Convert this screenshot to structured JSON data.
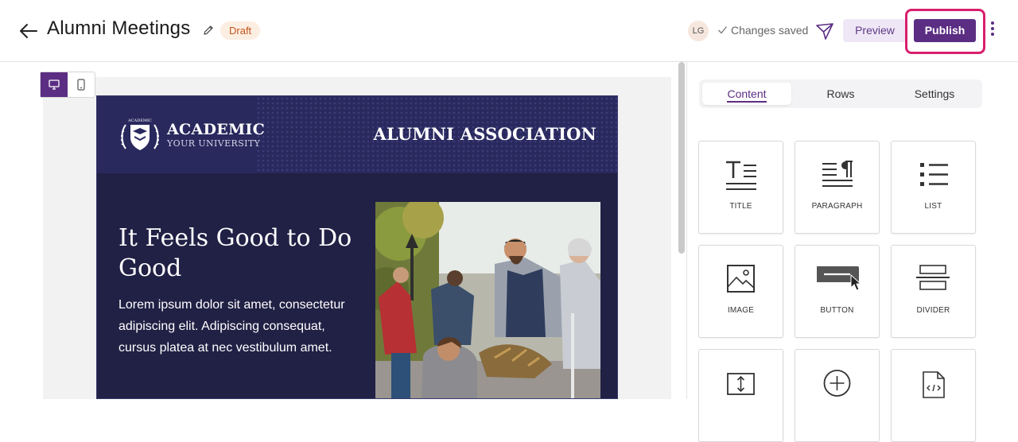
{
  "header": {
    "title": "Alumni Meetings",
    "status_badge": "Draft",
    "avatar_initials": "LG",
    "saved_text": "Changes saved",
    "preview_label": "Preview",
    "publish_label": "Publish",
    "accent_color": "#5b2d83",
    "highlight_color": "#d81f6c"
  },
  "email": {
    "logo_name": "ACADEMIC",
    "logo_sub": "YOUR UNIVERSITY",
    "logo_seal_text": "ACADEMIC",
    "association": "ALUMNI ASSOCIATION",
    "headline": "It Feels Good to Do Good",
    "body": "Lorem ipsum dolor sit amet, consectetur adipiscing elit. Adipiscing consequat, cursus platea at nec vestibulum amet.",
    "background_color": "#212045"
  },
  "panel": {
    "tabs": [
      {
        "label": "Content",
        "active": true
      },
      {
        "label": "Rows",
        "active": false
      },
      {
        "label": "Settings",
        "active": false
      }
    ],
    "tiles": [
      {
        "label": "TITLE",
        "icon": "title-icon"
      },
      {
        "label": "PARAGRAPH",
        "icon": "paragraph-icon"
      },
      {
        "label": "LIST",
        "icon": "list-icon"
      },
      {
        "label": "IMAGE",
        "icon": "image-icon"
      },
      {
        "label": "BUTTON",
        "icon": "button-icon"
      },
      {
        "label": "DIVIDER",
        "icon": "divider-icon"
      },
      {
        "label": "",
        "icon": "spacer-icon"
      },
      {
        "label": "",
        "icon": "social-icon"
      },
      {
        "label": "",
        "icon": "html-icon"
      }
    ]
  }
}
